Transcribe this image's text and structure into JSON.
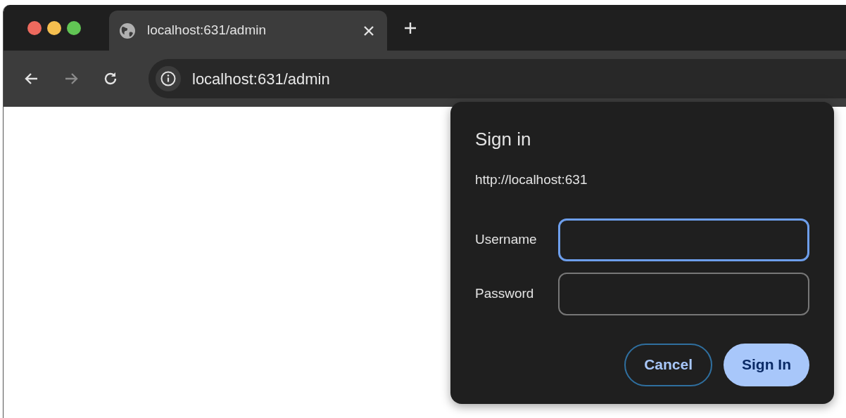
{
  "tabs": [
    {
      "title": "localhost:631/admin",
      "selected": true
    }
  ],
  "nav_buttons": [
    {
      "kind": "back",
      "disabled": false
    },
    {
      "kind": "forward",
      "disabled": true
    },
    {
      "kind": "reload",
      "disabled": false
    }
  ],
  "address_bar": {
    "url": "localhost:631/admin"
  },
  "dialog": {
    "title": "Sign in",
    "origin": "http://localhost:631",
    "fields": [
      {
        "label": "Username",
        "focused": true
      },
      {
        "label": "Password",
        "focused": false
      }
    ],
    "buttons": [
      {
        "label": "Cancel",
        "kind": "secondary"
      },
      {
        "label": "Sign In",
        "kind": "primary"
      }
    ]
  }
}
